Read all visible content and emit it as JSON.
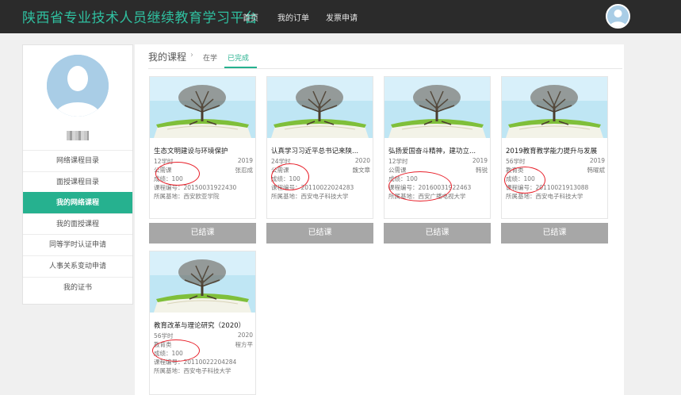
{
  "header": {
    "site_title": "陕西省专业技术人员继续教育学习平台",
    "nav": [
      "首页",
      "我的订单",
      "发票申请"
    ]
  },
  "sidebar": {
    "menu": [
      {
        "label": "网络课程目录",
        "active": false
      },
      {
        "label": "面授课程目录",
        "active": false
      },
      {
        "label": "我的网络课程",
        "active": true
      },
      {
        "label": "我的面授课程",
        "active": false
      },
      {
        "label": "同等学时认证申请",
        "active": false
      },
      {
        "label": "人事关系变动申请",
        "active": false
      },
      {
        "label": "我的证书",
        "active": false
      }
    ]
  },
  "main": {
    "breadcrumb": "我的课程",
    "tabs": [
      {
        "label": "在学",
        "active": false
      },
      {
        "label": "已完成",
        "active": true
      }
    ],
    "courses": [
      {
        "title": "生态文明建设与环境保护",
        "hours": "12学时",
        "year": "2019",
        "type": "公需课",
        "teacher": "张忍成",
        "score": "成绩：100",
        "code": "课程编号：20150031922430",
        "base": "所属基地：西安欧亚学院",
        "button": "已结课"
      },
      {
        "title": "认真学习习近平总书记来陕...",
        "hours": "24学时",
        "year": "2020",
        "type": "公需课",
        "teacher": "魏文章",
        "score": "成绩：100",
        "code": "课程编号：20110022024283",
        "base": "所属基地：西安电子科技大学",
        "button": "已结课"
      },
      {
        "title": "弘扬爱国奋斗精神，建功立...",
        "hours": "12学时",
        "year": "2019",
        "type": "公需课",
        "teacher": "韩锐",
        "score": "成绩：100",
        "code": "课程编号：20160031922463",
        "base": "所属基地：西安广播电视大学",
        "button": "已结课"
      },
      {
        "title": "2019教育教学能力提升与发展",
        "hours": "56学时",
        "year": "2019",
        "type": "教育类",
        "teacher": "韩曜斌",
        "score": "成绩：100",
        "code": "课程编号：20110021913088",
        "base": "所属基地：西安电子科技大学",
        "button": "已结课"
      },
      {
        "title": "教育改革与理论研究（2020）",
        "hours": "56学时",
        "year": "2020",
        "type": "教育类",
        "teacher": "程方平",
        "score": "成绩：100",
        "code": "课程编号：20110022204284",
        "base": "所属基地：西安电子科技大学",
        "button": ""
      }
    ]
  },
  "colors": {
    "accent": "#26b18f",
    "logo": "#2fc0a0",
    "header_bg": "#2b2b2b",
    "done_button": "#a7a7a7",
    "annotation": "#e8202a"
  },
  "icons": {
    "user_avatar": "user-avatar-icon",
    "breadcrumb_separator": "chevron-right-icon",
    "course_thumbnail": "tree-on-book-image"
  }
}
